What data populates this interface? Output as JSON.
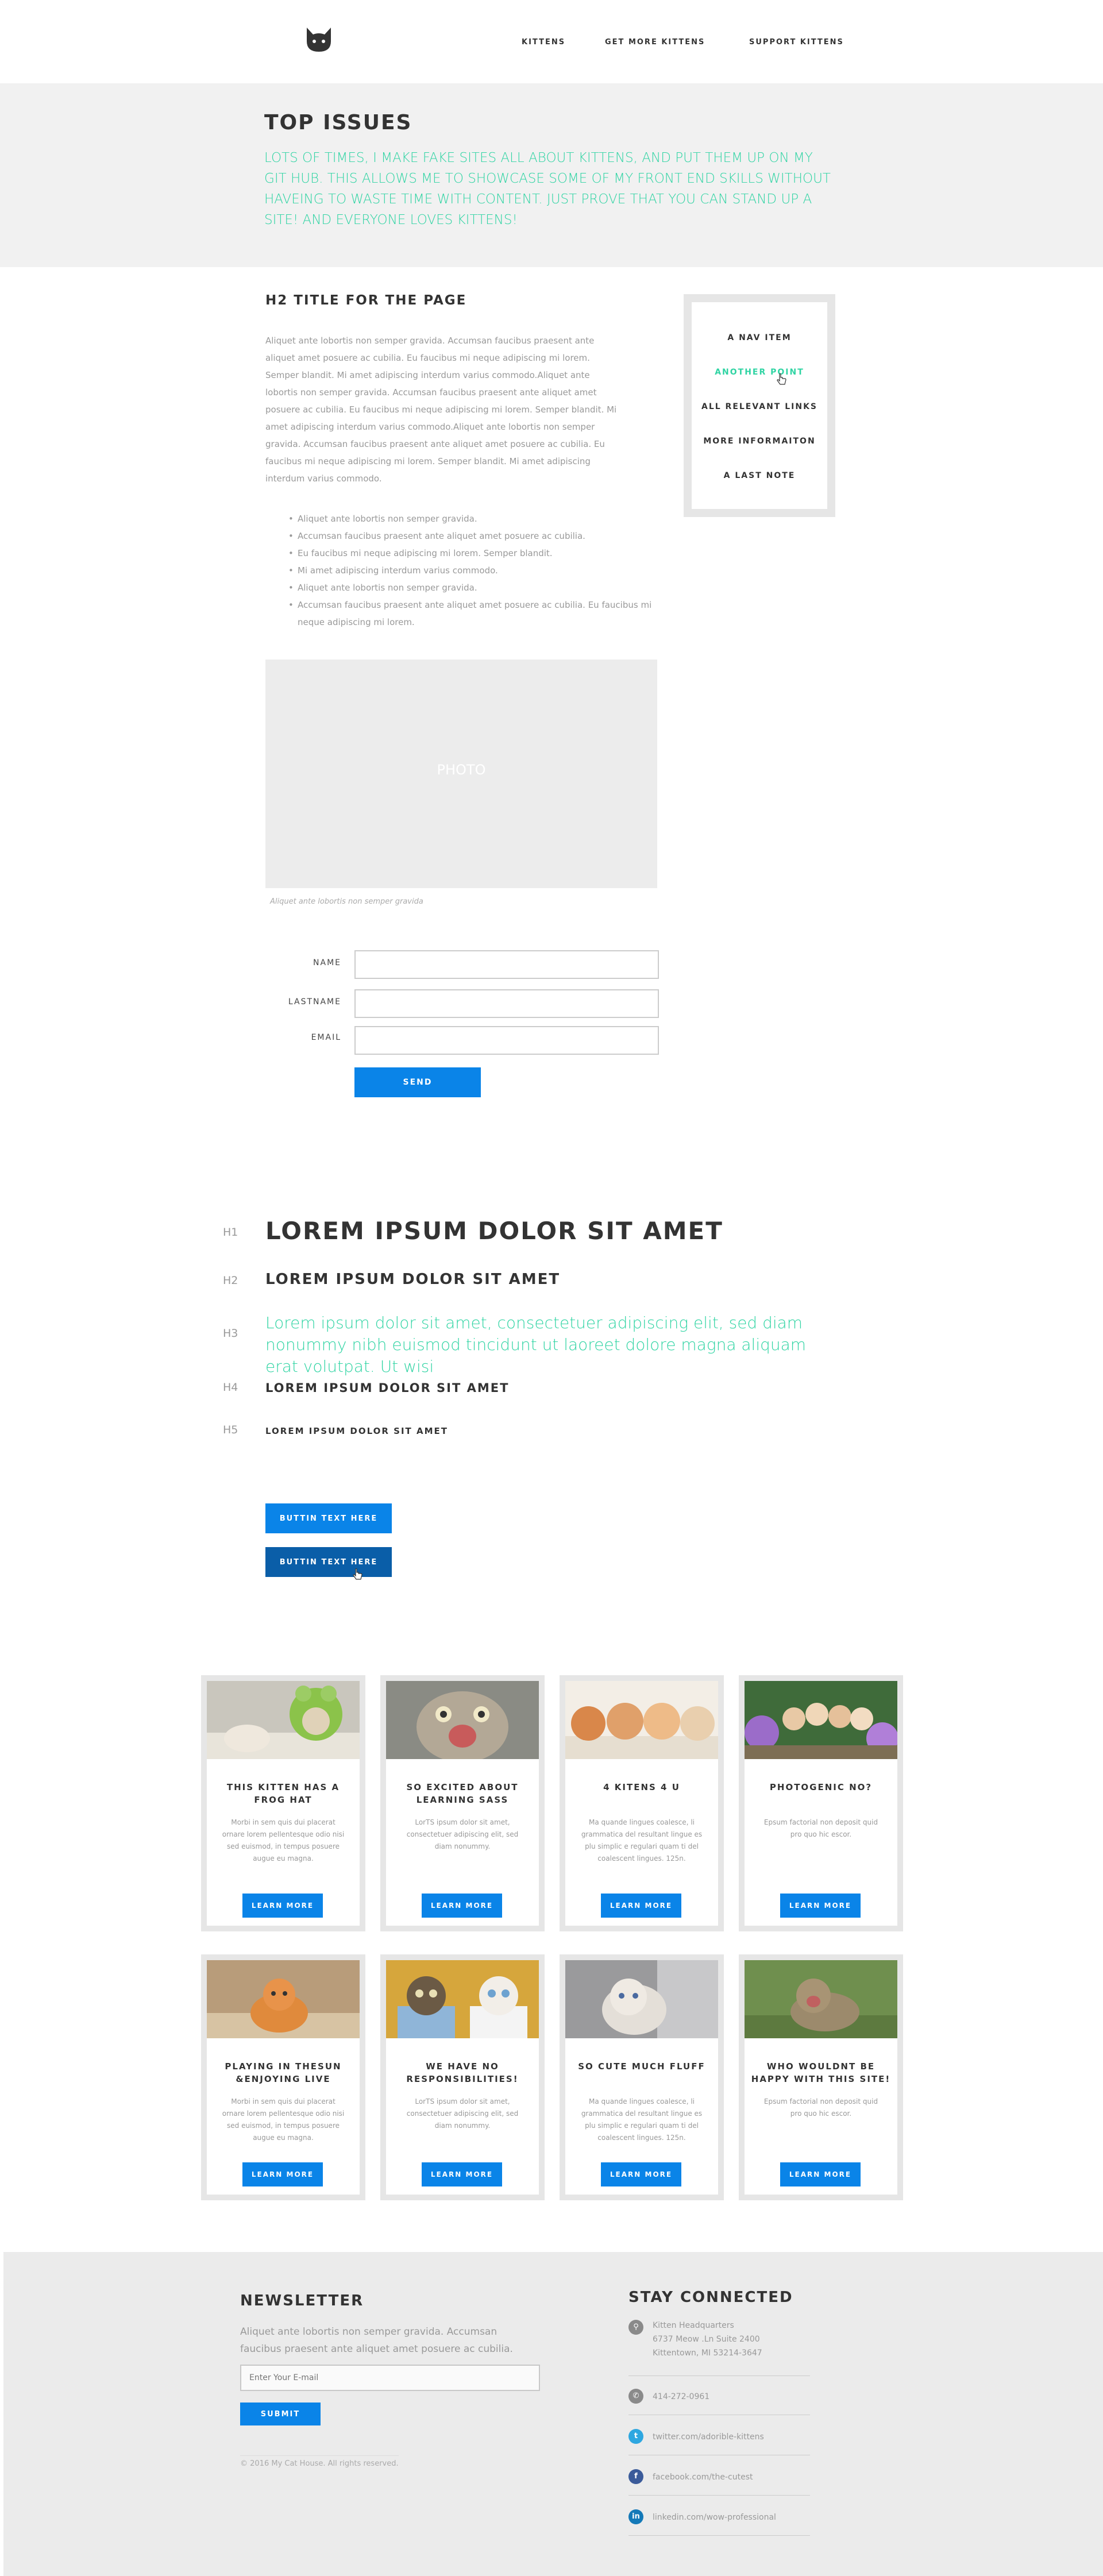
{
  "header": {
    "nav": [
      "KITTENS",
      "GET MORE KITTENS",
      "SUPPORT KITTENS"
    ]
  },
  "hero": {
    "title": "TOP ISSUES",
    "text": "LOTS OF TIMES, I MAKE FAKE SITES ALL ABOUT KITTENS, AND PUT THEM UP ON MY GIT HUB.  THIS ALLOWS ME TO SHOWCASE SOME OF MY FRONT END SKILLS WITHOUT HAVEING TO WASTE TIME WITH CONTENT. JUST PROVE THAT YOU CAN STAND UP A SITE!  AND EVERYONE LOVES KITTENS!"
  },
  "content": {
    "title": "H2 TITLE FOR THE PAGE",
    "body": "Aliquet ante lobortis non semper gravida. Accumsan faucibus praesent ante aliquet amet posuere ac cubilia. Eu faucibus mi neque adipiscing mi lorem. Semper blandit. Mi amet adipiscing interdum varius commodo.Aliquet ante lobortis non semper gravida. Accumsan faucibus praesent ante aliquet amet posuere ac cubilia. Eu faucibus mi neque adipiscing mi lorem. Semper blandit. Mi amet adipiscing interdum varius commodo.Aliquet ante lobortis non semper gravida. Accumsan faucibus praesent ante aliquet amet posuere ac cubilia. Eu faucibus mi neque adipiscing mi lorem. Semper blandit. Mi amet adipiscing interdum varius commodo.",
    "bullets": [
      "Aliquet ante lobortis non semper gravida.",
      "Accumsan faucibus praesent ante aliquet amet posuere ac cubilia.",
      "Eu faucibus mi neque adipiscing mi lorem. Semper blandit.",
      "Mi amet adipiscing interdum varius commodo.",
      "Aliquet ante lobortis non semper gravida.",
      "Accumsan faucibus praesent ante aliquet amet posuere ac cubilia. Eu faucibus mi neque adipiscing mi lorem."
    ],
    "photo_label": "PHOTO",
    "photo_caption": "Aliquet ante lobortis non semper gravida"
  },
  "sidebar": {
    "items": [
      "A NAV ITEM",
      "ANOTHER POINT",
      "ALL RELEVANT LINKS",
      "MORE INFORMAITON",
      "A LAST NOTE"
    ],
    "active_index": 1
  },
  "form": {
    "name_label": "NAME",
    "lastname_label": "LASTNAME",
    "email_label": "EMAIL",
    "name_value": "",
    "lastname_value": "",
    "email_value": "",
    "send_label": "SEND"
  },
  "typography": {
    "h1_tag": "H1",
    "h1": "LOREM IPSUM DOLOR SIT AMET",
    "h2_tag": "H2",
    "h2": "LOREM IPSUM DOLOR SIT AMET",
    "h3_tag": "H3",
    "h3": "Lorem ipsum dolor sit amet, consectetuer adipiscing elit, sed diam nonummy nibh euismod tincidunt ut laoreet dolore magna aliquam erat volutpat. Ut wisi",
    "h4_tag": "H4",
    "h4": "LOREM IPSUM DOLOR SIT AMET",
    "h5_tag": "H5",
    "h5": "LOREM IPSUM DOLOR SIT AMET",
    "button_primary": "BUTTIN TEXT HERE",
    "button_hover": "BUTTIN TEXT HERE"
  },
  "cards": [
    {
      "title": "THIS KITTEN HAS A FROG HAT",
      "text": "Morbi in sem quis dui placerat ornare lorem pellentesque odio nisi sed euismod, in tempus posuere augue eu magna.",
      "button": "LEARN MORE",
      "img": "frog-hat-kitten"
    },
    {
      "title": "SO EXCITED ABOUT LEARNING SASS",
      "text": "LorTS ipsum dolor sit amet, consectetuer adipiscing elit, sed diam nonummy.",
      "button": "LEARN MORE",
      "img": "excited-kitten"
    },
    {
      "title": "4 KITENS 4 U",
      "text": "Ma quande lingues coalesce, li grammatica del resultant lingue es plu simplic e regulari quam ti del coalescent lingues. 125n.",
      "button": "LEARN MORE",
      "img": "four-kittens"
    },
    {
      "title": "PHOTOGENIC NO?",
      "text": "Epsum factorial non deposit quid pro quo hic escor.",
      "button": "LEARN MORE",
      "img": "photogenic-kittens"
    },
    {
      "title": "PLAYING IN THESUN &ENJOYING LIVE",
      "text": "Morbi in sem quis dui placerat ornare lorem pellentesque odio nisi sed euismod, in tempus posuere augue eu magna.",
      "button": "LEARN MORE",
      "img": "orange-kitten"
    },
    {
      "title": "WE HAVE NO RESPONSIBILITIES!",
      "text": "LorTS ipsum dolor sit amet, consectetuer adipiscing elit, sed diam nonummy.",
      "button": "LEARN MORE",
      "img": "cup-kittens"
    },
    {
      "title": "SO CUTE MUCH FLUFF",
      "text": "Ma quande lingues coalesce, li grammatica del resultant lingue es plu simplic e regulari quam ti del coalescent lingues. 125n.",
      "button": "LEARN MORE",
      "img": "fluffy-kitten"
    },
    {
      "title": "WHO WOULDNT BE HAPPY WITH THIS SITE!",
      "text": "Epsum factorial non deposit quid pro quo hic escor.",
      "button": "LEARN MORE",
      "img": "happy-tabby-kitten"
    }
  ],
  "footer": {
    "newsletter_title": "NEWSLETTER",
    "newsletter_text": "Aliquet ante lobortis non semper gravida. Accumsan faucibus praesent ante aliquet amet posuere ac cubilia.",
    "newsletter_placeholder": "Enter Your E-mail",
    "submit_label": "SUBMIT",
    "copyright": "© 2016 My Cat House. All rights reserved.",
    "stay_title": "STAY CONNECTED",
    "address_line1": "Kitten Headquarters",
    "address_line2": "6737 Meow .Ln Suite 2400",
    "address_line3": "Kittentown, MI 53214-3647",
    "phone": "414-272-0961",
    "twitter": "twitter.com/adorible-kittens",
    "facebook": "facebook.com/the-cutest",
    "linkedin": "linkedin.com/wow-professional"
  },
  "colors": {
    "accent_teal": "#2fd4a3",
    "primary_blue": "#0a84e8",
    "hover_blue": "#0a5ea8"
  }
}
